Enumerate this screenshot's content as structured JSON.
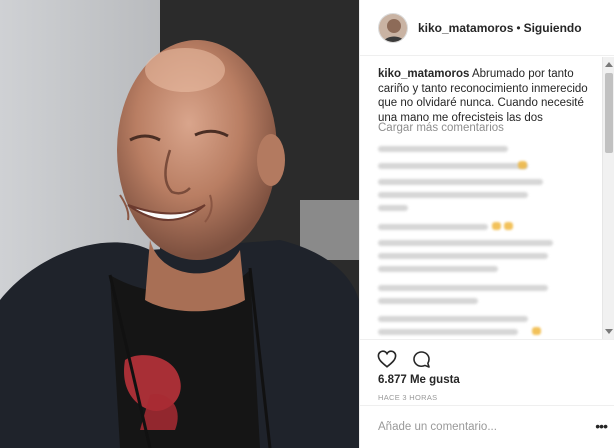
{
  "post": {
    "username": "kiko_matamoros",
    "separator": "•",
    "follow_status": "Siguiendo"
  },
  "caption": {
    "username": "kiko_matamoros",
    "text": "Abrumado por tanto cariño y tanto reconocimiento inmerecido que no olvidaré nunca. Cuando necesité una mano me ofrecisteis las dos"
  },
  "comments": {
    "load_more": "Cargar más comentarios"
  },
  "actions": {
    "likes": "6.877 Me gusta",
    "time_ago": "HACE 3 HORAS"
  },
  "add_comment": {
    "placeholder": "Añade un comentario..."
  },
  "icons": {
    "like": "heart-icon",
    "comment": "comment-bubble-icon",
    "more": "ellipsis-icon"
  },
  "colors": {
    "text": "#262626",
    "muted": "#999999",
    "border": "#efefef",
    "shirt_print": "#c0392b"
  }
}
